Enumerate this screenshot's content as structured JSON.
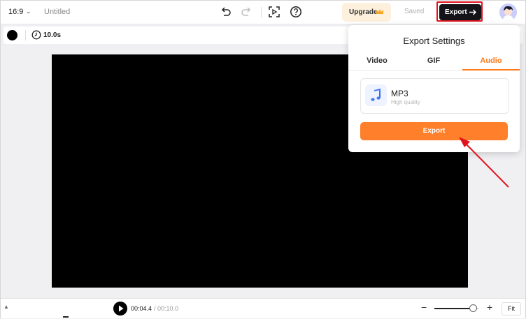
{
  "header": {
    "aspect_ratio": "16:9",
    "document_title": "Untitled",
    "upgrade_label": "Upgrade",
    "saved_label": "Saved",
    "export_label": "Export"
  },
  "toolbar": {
    "duration": "10.0s"
  },
  "export_panel": {
    "title": "Export Settings",
    "tabs": [
      {
        "label": "Video"
      },
      {
        "label": "GIF"
      },
      {
        "label": "Audio"
      }
    ],
    "active_tab": "Audio",
    "format": {
      "name": "MP3",
      "quality": "High quality"
    },
    "export_button_label": "Export"
  },
  "playback": {
    "current_time": "00:04.4",
    "total_time": "/ 00:10.0",
    "fit_label": "Fit",
    "zoom_level": 0.85
  },
  "colors": {
    "accent": "#ff7f2a",
    "highlight": "#e0141e",
    "dark_button": "#131318"
  }
}
